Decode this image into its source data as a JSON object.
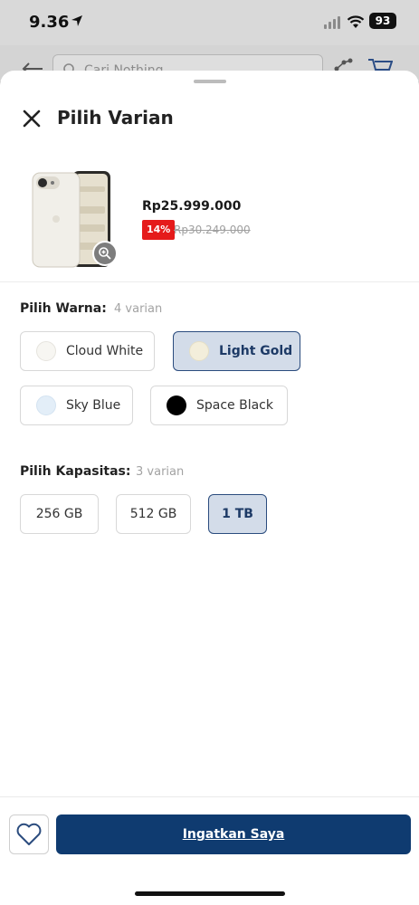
{
  "status": {
    "time": "9.36",
    "battery": "93"
  },
  "header": {
    "search_placeholder": "Cari Nothing"
  },
  "sheet": {
    "title": "Pilih Varian",
    "product": {
      "price": "Rp25.999.000",
      "discount": "14%",
      "original_price": "Rp30.249.000"
    },
    "color_section": {
      "label": "Pilih Warna:",
      "count": "4 varian",
      "options": [
        {
          "name": "Cloud White",
          "swatch": "#f7f6f2",
          "selected": false
        },
        {
          "name": "Light Gold",
          "swatch": "#f3eedb",
          "selected": true
        },
        {
          "name": "Sky Blue",
          "swatch": "#e3eef8",
          "selected": false
        },
        {
          "name": "Space Black",
          "swatch": "#000000",
          "selected": false
        }
      ]
    },
    "capacity_section": {
      "label": "Pilih Kapasitas:",
      "count": "3 varian",
      "options": [
        {
          "name": "256 GB",
          "selected": false
        },
        {
          "name": "512 GB",
          "selected": false
        },
        {
          "name": "1 TB",
          "selected": true
        }
      ]
    }
  },
  "footer": {
    "cta_label": "Ingatkan Saya"
  },
  "colors": {
    "primary": "#0f3b70",
    "selected_bg": "#d3dce9",
    "discount": "#e51b1b"
  }
}
